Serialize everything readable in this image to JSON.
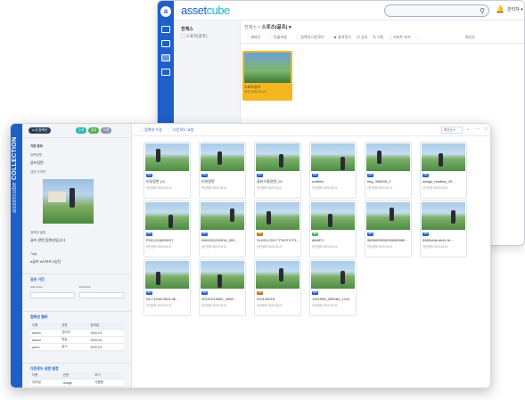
{
  "back_window": {
    "logo_a": "asset",
    "logo_b": "cube",
    "user_label": "관리자 ▾",
    "left_title": "전체스",
    "left_item": "▢ 스포츠(골프)",
    "crumb_prefix": "전체스 >",
    "crumb_current": "스포츠(골프) ▾",
    "tools": [
      "⬚ 새자인",
      "⬚ 반출요청",
      "⬚ 컴렉션 다운로드",
      "★ 즐겨찾기",
      "⇄ 공유",
      "⇅ 이동",
      "⬚ 리포트 보기",
      "…"
    ],
    "sort_label": "최신순",
    "card_title": "스포츠골프",
    "card_sub": "자산 2020.03.21"
  },
  "front_window": {
    "rail_bold": "assetcube",
    "rail_light": " COLLECTION",
    "side": {
      "tag": "● 내 컴렉션",
      "buttons": [
        "수정",
        "공유",
        "삭제"
      ],
      "info_label": "기본 정보",
      "name_label": "컴렉션명",
      "name_value": "골프장면",
      "thumb_label": "대표 이미지",
      "desc_label": "컴렉션 설명",
      "desc_value": "골프 관련 컴렉션입니다.",
      "tag_label": "Tags",
      "tag_value": "#골프 #스포츠 #상단",
      "period_title": "공유 기간",
      "start_label": "Start Date",
      "end_label": "End Date",
      "member_title": "컴렉션 멤버",
      "member_headers": [
        "이름",
        "권한",
        "등록일"
      ],
      "members": [
        [
          "admin",
          "관리자",
          "2020-03"
        ],
        [
          "kwone",
          "편집",
          "2020-03"
        ],
        [
          "jdoon",
          "읽기",
          "2020-03"
        ]
      ],
      "perm_title": "다운로드 권한 설정",
      "perm_headers": [
        "이름",
        "권한",
        "보기"
      ],
      "perms": [
        [
          "우리팀",
          "Usage",
          "사용함"
        ]
      ]
    },
    "toolbar": {
      "btn1": "⬚ 컴렉션 수정",
      "btn2": "⬚ 다운로드 요청",
      "sort_label": "최신순 ▾"
    },
    "assets": [
      {
        "title": "티샷장면 (1)",
        "sub": "자산정보 2020.03.21",
        "badge": "IMG",
        "color": "#1e5fc8"
      },
      {
        "title": "티샷장면",
        "sub": "자산정보 2020.03.21",
        "badge": "IMG",
        "color": "#1e5fc8"
      },
      {
        "title": "골프스윙장면_02",
        "sub": "자산정보 2020.03.21",
        "badge": "IMG",
        "color": "#1e5fc8"
      },
      {
        "title": "untitled",
        "sub": "자산정보 2020.03.21",
        "badge": "IMG",
        "color": "#1e5fc8"
      },
      {
        "title": "img_358905_1",
        "sub": "자산정보 2020.03.21",
        "badge": "IMG",
        "color": "#1e5fc8"
      },
      {
        "title": "image_readtop_20...",
        "sub": "자산정보 2020.03.21",
        "badge": "IMG",
        "color": "#1e5fc8"
      },
      {
        "title": "P02121280DE07",
        "sub": "자산정보 2020.03.21",
        "badge": "IMG",
        "color": "#1e5fc8"
      },
      {
        "title": "IN00001290914_000...",
        "sub": "자산정보 2020.03.21",
        "badge": "IMG",
        "color": "#1e5fc8"
      },
      {
        "title": "SL0914 2017 PHOTO PL...",
        "sub": "자산정보 2020.03.21",
        "badge": "VID",
        "color": "#c9731a"
      },
      {
        "title": "884871",
        "sub": "자산정보 2020.03.21",
        "badge": "IMG",
        "color": "#4fae5a"
      },
      {
        "title": "9805005090099050580...",
        "sub": "자산정보 2020.03.21",
        "badge": "IMG",
        "color": "#1e5fc8"
      },
      {
        "title": "5A55cfde.db4f..fe...",
        "sub": "자산정보 2020.03.21",
        "badge": "IMG",
        "color": "#1e5fc8"
      },
      {
        "title": "NC71208-0815-rfe...",
        "sub": "자산정보 2020.03.21",
        "badge": "IMG",
        "color": "#1e5fc8"
      },
      {
        "title": "20151015062_1898...",
        "sub": "자산정보 2020.03.21",
        "badge": "IMG",
        "color": "#1e5fc8"
      },
      {
        "title": "2021/05/18",
        "sub": "자산정보 2020.03.21",
        "badge": "VID",
        "color": "#c9731a"
      },
      {
        "title": "1321908_255484_1214",
        "sub": "자산정보 2020.03.21",
        "badge": "IMG",
        "color": "#1e5fc8"
      }
    ]
  }
}
